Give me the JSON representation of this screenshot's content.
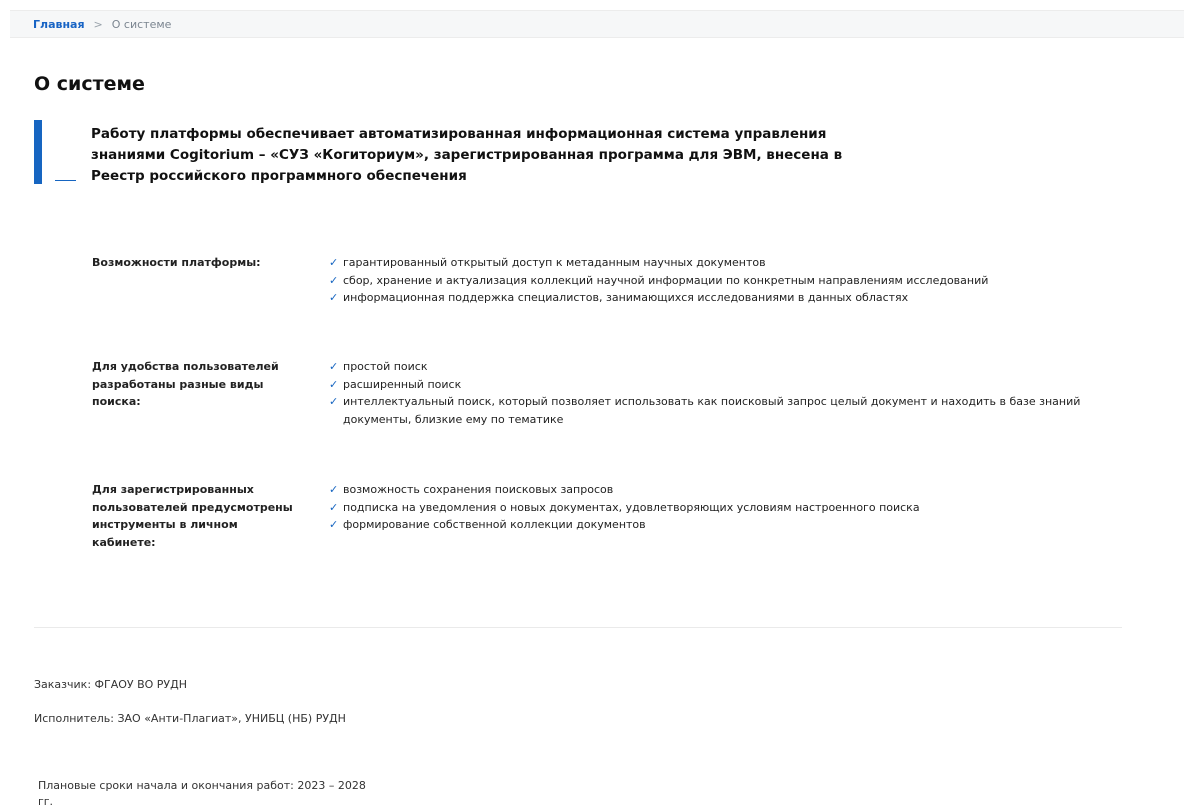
{
  "breadcrumb": {
    "home": "Главная",
    "separator": ">",
    "current": "О системе"
  },
  "page_title": "О системе",
  "lead_text": "Работу платформы обеспечивает автоматизированная информационная система управления знаниями Cogitorium – «СУЗ «Когиториум», зарегистрированная программа для ЭВМ, внесена в Реестр российского программного обеспечения",
  "sections": [
    {
      "label": "Возможности платформы:",
      "items": [
        "гарантированный открытый доступ к метаданным научных документов",
        "сбор, хранение и актуализация коллекций научной информации по конкретным направлениям исследований",
        "информационная поддержка специалистов, занимающихся исследованиями в данных областях"
      ]
    },
    {
      "label": "Для удобства пользователей разработаны разные виды поиска:",
      "items": [
        "простой поиск",
        "расширенный поиск",
        "интеллектуальный поиск, который позволяет использовать как поисковый запрос целый документ и находить в базе знаний документы, близкие ему по тематике"
      ]
    },
    {
      "label": "Для зарегистрированных пользователей предусмотрены инструменты в личном кабинете:",
      "items": [
        "возможность сохранения поисковых запросов",
        "подписка на уведомления о новых документах, удовлетворяющих условиям настроенного поиска",
        "формирование собственной коллекции документов"
      ]
    }
  ],
  "check_glyph": "✓",
  "footer": {
    "customer": "Заказчик: ФГАОУ ВО РУДН",
    "contractor": "Исполнитель: ЗАО «Анти-Плагиат», УНИБЦ (НБ) РУДН",
    "terms": "Плановые сроки начала и окончания работ: 2023 – 2028 гг."
  },
  "colors": {
    "accent": "#1665c1",
    "link": "#1763c4"
  }
}
